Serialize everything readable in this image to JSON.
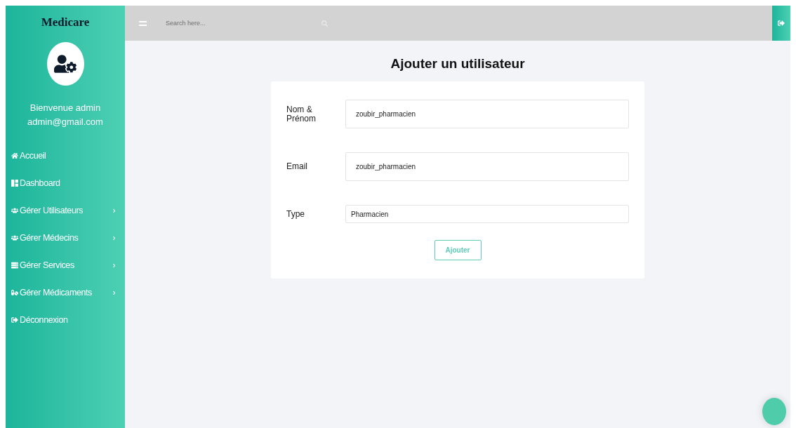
{
  "sidebar": {
    "brand": "Medicare",
    "greeting": "Bienvenue admin",
    "email": "admin@gmail.com",
    "items": [
      {
        "label": "Accueil",
        "kind": "home"
      },
      {
        "label": "Dashboard",
        "kind": "dashboard"
      },
      {
        "label": "Gérer Utilisateurs",
        "kind": "users",
        "submenu_mark": "›"
      },
      {
        "label": "Gérer Médecins",
        "kind": "users",
        "submenu_mark": "›"
      },
      {
        "label": "Gérer Services",
        "kind": "server",
        "submenu_mark": "›"
      },
      {
        "label": "Gérer Médicaments",
        "kind": "pills",
        "submenu_mark": "›"
      },
      {
        "label": "Déconnexion",
        "kind": "logout"
      }
    ]
  },
  "topbar": {
    "search": {
      "placeholder": "Search here..."
    }
  },
  "form": {
    "title": "Ajouter un utilisateur",
    "fields": [
      {
        "label": "Nom & Prénom",
        "value": "zoubir_pharmacien",
        "kind": "text"
      },
      {
        "label": "Email",
        "value": "zoubir_pharmacien",
        "kind": "text"
      },
      {
        "label": "Type",
        "value": "Pharmacien",
        "kind": "select"
      }
    ],
    "submit": "Ajouter"
  }
}
